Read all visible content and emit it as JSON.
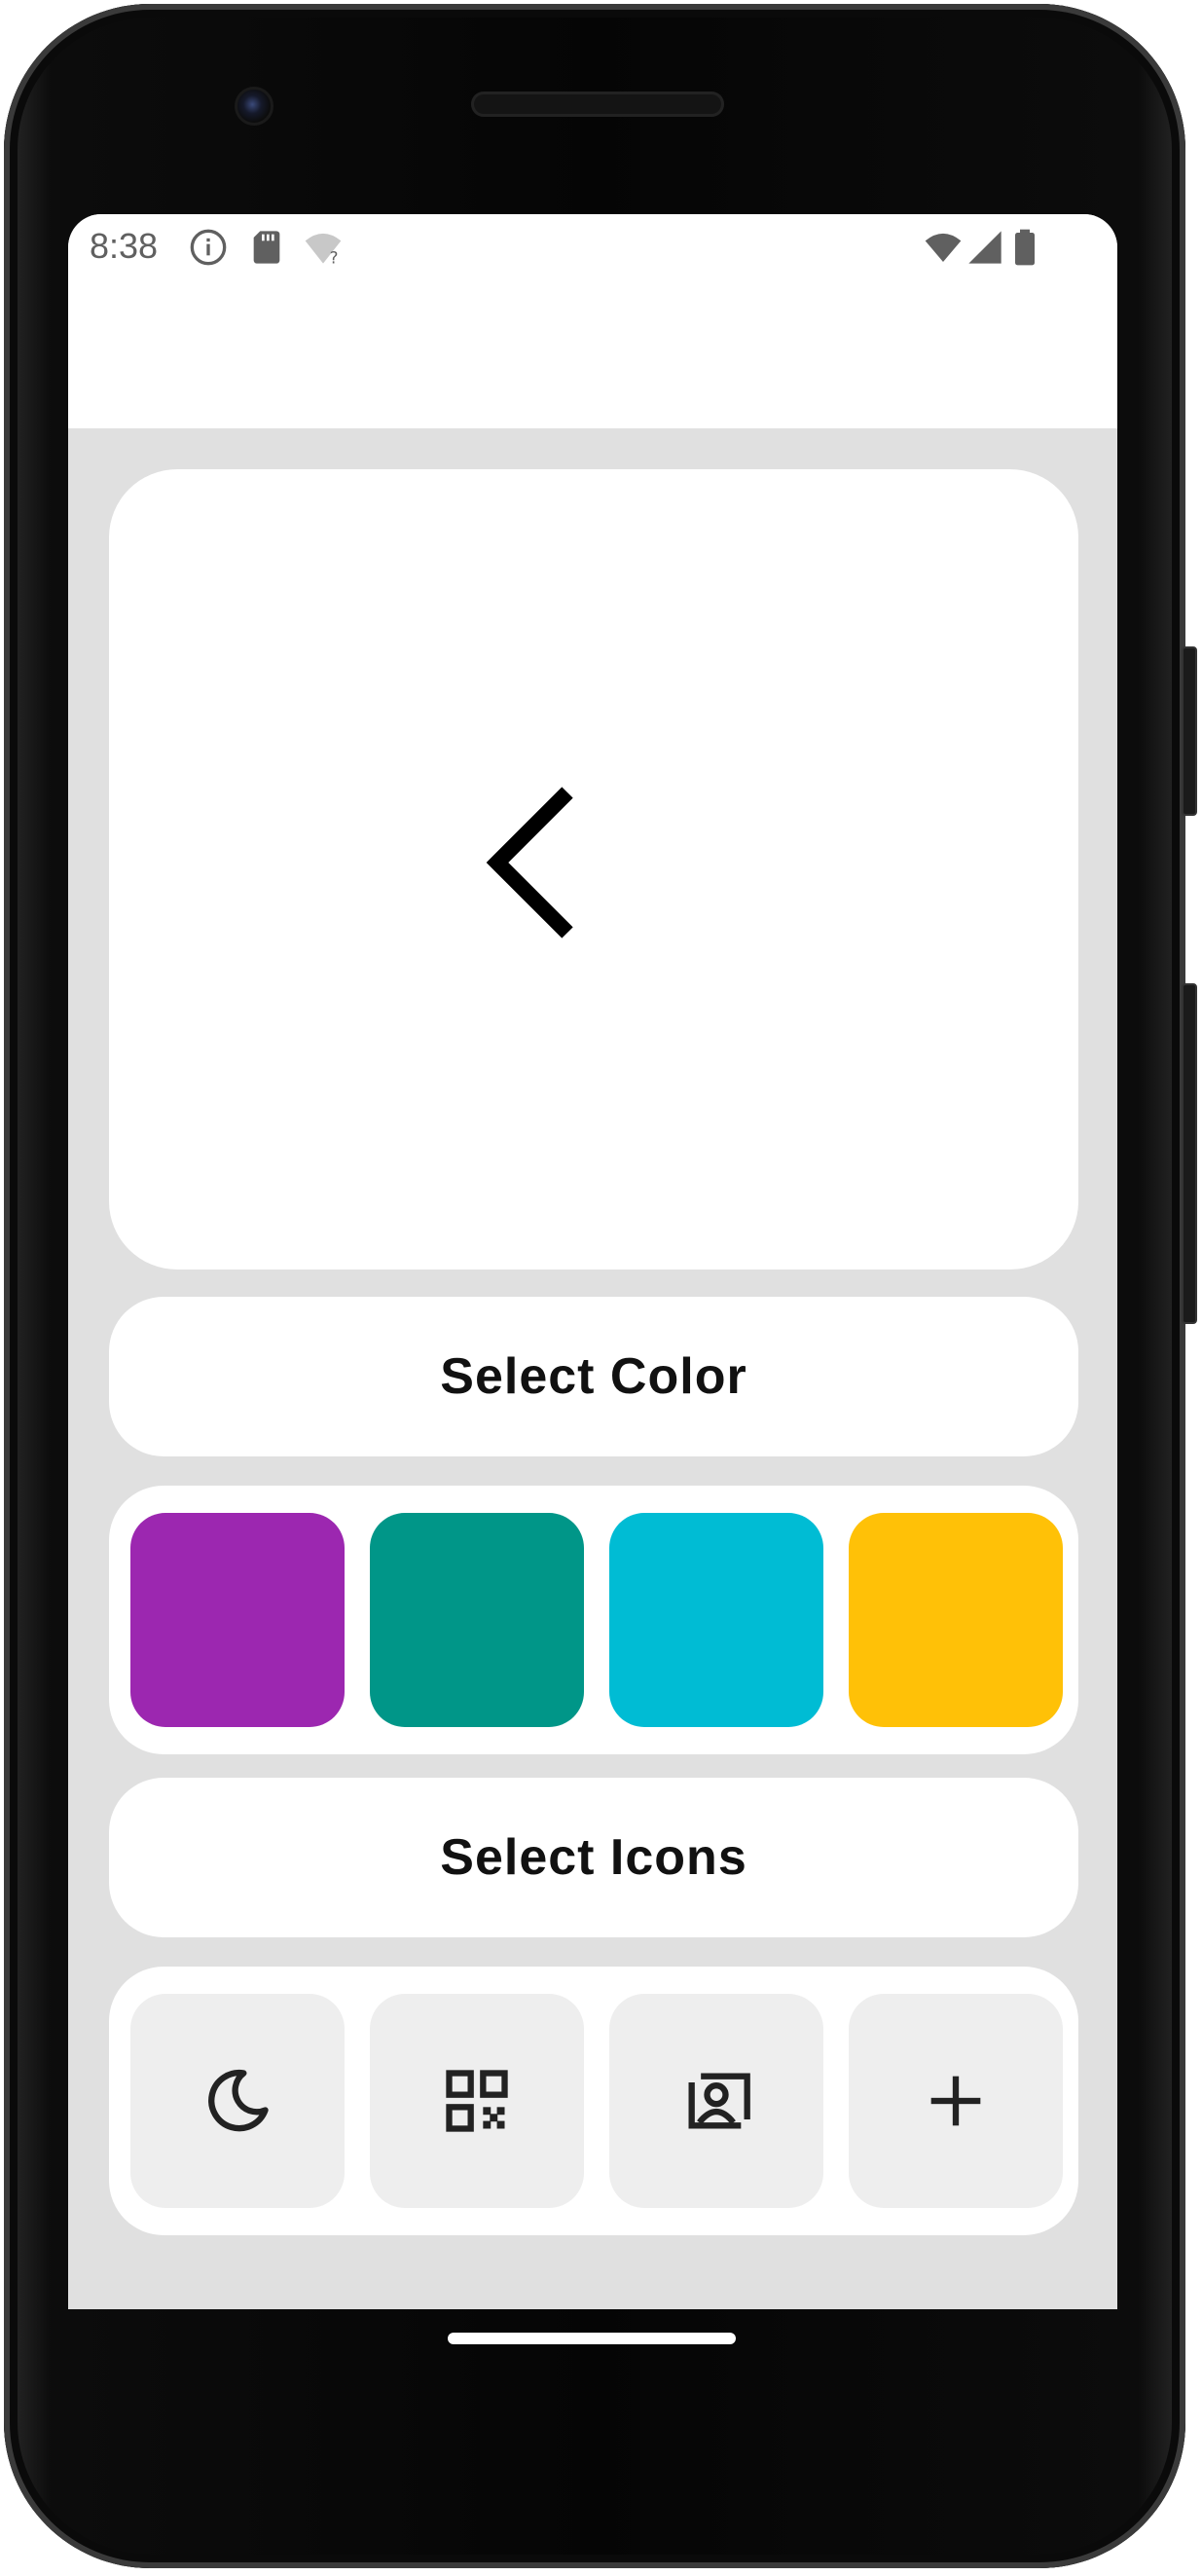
{
  "status_bar": {
    "time": "8:38",
    "left_icons": [
      "info-icon",
      "sd-card-icon",
      "wifi-unknown-icon"
    ],
    "right_icons": [
      "wifi-icon",
      "signal-icon",
      "battery-icon"
    ]
  },
  "preview": {
    "icon": "chevron-left-icon",
    "icon_color": "#000000",
    "background": "#ffffff"
  },
  "color_section": {
    "label": "Select Color",
    "swatches": [
      {
        "name": "purple",
        "color": "#9c27b0"
      },
      {
        "name": "teal",
        "color": "#009688"
      },
      {
        "name": "cyan",
        "color": "#00bcd4"
      },
      {
        "name": "amber",
        "color": "#ffc107"
      }
    ]
  },
  "icon_section": {
    "label": "Select Icons",
    "icons": [
      "moon-icon",
      "qr-code-icon",
      "contact-card-icon",
      "plus-icon"
    ]
  },
  "colors": {
    "screen_background": "#e0e0e0",
    "card_background": "#ffffff",
    "tile_background": "#eeeeee"
  }
}
